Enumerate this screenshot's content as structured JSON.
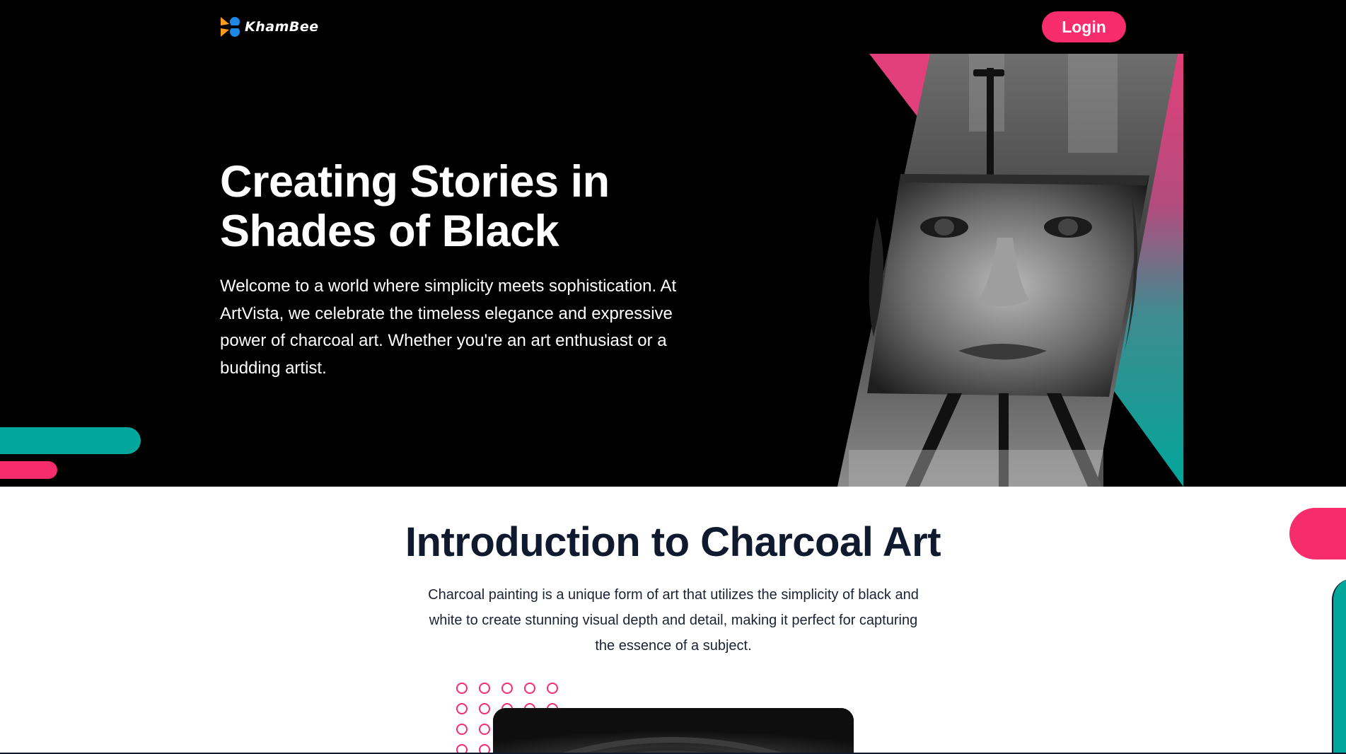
{
  "header": {
    "logo_text": "KhamBee",
    "login_label": "Login"
  },
  "hero": {
    "title": "Creating Stories in Shades of Black",
    "description": "Welcome to a world where simplicity meets sophistication. At ArtVista, we celebrate the timeless elegance and expressive power of charcoal art. Whether you're an art enthusiast or a budding artist."
  },
  "intro": {
    "title": "Introduction to Charcoal Art",
    "description": "Charcoal painting is a unique form of art that utilizes the simplicity of black and white to create stunning visual depth and detail, making it perfect for capturing the essence of a subject."
  },
  "colors": {
    "accent_pink": "#f72c6c",
    "accent_teal": "#02a69b",
    "hero_bg": "#000000",
    "heading_dark": "#0f1a2e"
  },
  "icons": {
    "logo": "khambee-logo-icon",
    "hero_image": "charcoal-portrait-on-easel"
  }
}
